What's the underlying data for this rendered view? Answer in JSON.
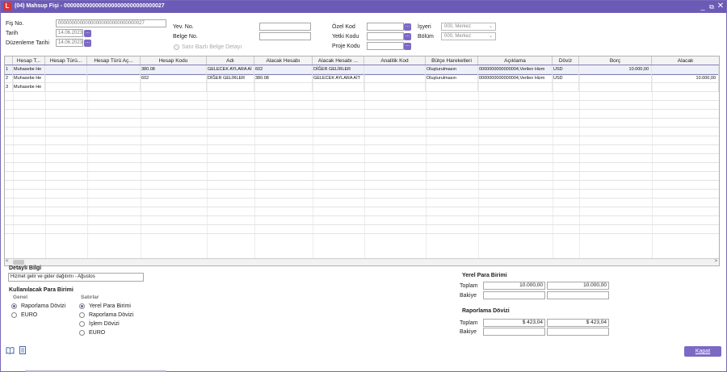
{
  "window": {
    "title": "(04) Mahsup Fişi - 00000000000000000000000000000027",
    "logo": "L"
  },
  "header": {
    "fis_no": {
      "label": "Fiş No.",
      "value": "00000000000000000000000000000027"
    },
    "tarih": {
      "label": "Tarih",
      "value": "14.06.2023"
    },
    "duzenleme_tarihi": {
      "label": "Düzenleme Tarihi",
      "value": "14.06.2023"
    },
    "yev_no": {
      "label": "Yev. No.",
      "value": ""
    },
    "belge_no": {
      "label": "Belge No.",
      "value": ""
    },
    "satir_bazli": {
      "label": "Satır Bazlı Belge Detayı"
    },
    "ozel_kod": {
      "label": "Özel Kod",
      "value": ""
    },
    "yetki_kodu": {
      "label": "Yetki Kodu",
      "value": ""
    },
    "proje_kodu": {
      "label": "Proje Kodu",
      "value": ""
    },
    "isyeri": {
      "label": "İşyeri",
      "value": "000, Merkez"
    },
    "bolum": {
      "label": "Bölüm",
      "value": "000, Merkez"
    },
    "button_glyph": "..."
  },
  "grid": {
    "columns": [
      "Hesap T...",
      "Hesap Türü...",
      "Hesap Türü Aç...",
      "Hesap Kodu",
      "Adı",
      "Alacak Hesabı",
      "Alacak Hesabı ...",
      "Analitik Kod",
      "Bütçe Hareketleri",
      "Açıklama",
      "Döviz",
      "Borç",
      "Alacak"
    ],
    "rows": [
      {
        "no": "1",
        "hesap_t": "Muhasebe He",
        "hesap_turu": "",
        "hesap_turu_ac": "",
        "hesap_kodu": "380.08",
        "adi": "GELECEK AYLARA Aİ",
        "alacak_hesabi": "602",
        "alacak_hesabi_adi": "DİĞER GELİRLER",
        "analitik": "",
        "butce": "Oluşturulmasın",
        "aciklama": "0000000000000004,Verilen Hizm",
        "doviz": "USD",
        "borc": "10.000,00",
        "alacak": ""
      },
      {
        "no": "2",
        "hesap_t": "Muhasebe He",
        "hesap_turu": "",
        "hesap_turu_ac": "",
        "hesap_kodu": "602",
        "adi": "DİĞER GELİRLER",
        "alacak_hesabi": "380.08",
        "alacak_hesabi_adi": "GELECEK AYLARA AİT",
        "analitik": "",
        "butce": "Oluşturulmasın",
        "aciklama": "0000000000000004,Verilen Hizm",
        "doviz": "USD",
        "borc": "",
        "alacak": "10.000,00"
      },
      {
        "no": "3",
        "hesap_t": "Muhasebe He",
        "hesap_turu": "",
        "hesap_turu_ac": "",
        "hesap_kodu": "",
        "adi": "",
        "alacak_hesabi": "",
        "alacak_hesabi_adi": "",
        "analitik": "",
        "butce": "",
        "aciklama": "",
        "doviz": "",
        "borc": "",
        "alacak": ""
      }
    ],
    "scroll_left": "<",
    "scroll_right": ">"
  },
  "detayli_bilgi": {
    "label": "Detaylı Bilgi",
    "value": "Hizmet gelir ve gider dağıtımı - Ağustos"
  },
  "para_birimi": {
    "title": "Kullanılacak Para Birimi",
    "genel": {
      "label": "Genel",
      "options": [
        "Raporlama Dövizi",
        "EURO"
      ],
      "selected": 0
    },
    "satirlar": {
      "label": "Satırlar",
      "options": [
        "Yerel Para Birimi",
        "Raporlama Dövizi",
        "İşlem Dövizi",
        "EURO"
      ],
      "selected": 0
    }
  },
  "totals": {
    "yerel": {
      "title": "Yerel Para Birimi",
      "toplam_label": "Toplam",
      "bakiye_label": "Bakiye",
      "toplam_borc": "10.000,00",
      "toplam_alacak": "10.000,00",
      "bakiye_borc": "",
      "bakiye_alacak": ""
    },
    "raporlama": {
      "title": "Raporlama Dövizi",
      "toplam_label": "Toplam",
      "bakiye_label": "Bakiye",
      "toplam_borc": "$ 423,04",
      "toplam_alacak": "$ 423,04",
      "bakiye_borc": "",
      "bakiye_alacak": ""
    }
  },
  "footer": {
    "kapat_label": "Kapat",
    "icons": [
      "book-icon",
      "document-icon"
    ]
  },
  "colors": {
    "titlebar": "#6c5bb6",
    "button": "#7c69c4",
    "logo": "#e03030"
  }
}
